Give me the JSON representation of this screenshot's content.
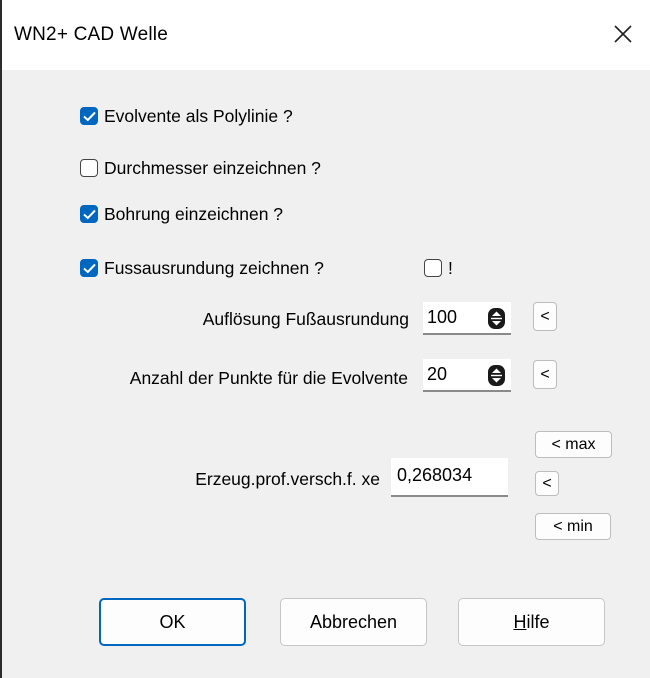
{
  "window": {
    "title": "WN2+ CAD Welle"
  },
  "options": [
    {
      "label": "Evolvente als Polylinie ?",
      "checked": true
    },
    {
      "label": "Durchmesser einzeichnen ?",
      "checked": false
    },
    {
      "label": "Bohrung einzeichnen ?",
      "checked": true
    },
    {
      "label": "Fussausrundung zeichnen ?",
      "checked": true
    }
  ],
  "extra_checkbox": {
    "label": "!",
    "checked": false
  },
  "resolution": {
    "label": "Auflösung Fußausrundung",
    "value": "100",
    "reset_label": "<"
  },
  "points": {
    "label": "Anzahl der Punkte für die Evolvente",
    "value": "20",
    "reset_label": "<"
  },
  "xe": {
    "label": "Erzeug.prof.versch.f. xe",
    "value": "0,268034",
    "max_label": "< max",
    "reset_label": "<",
    "min_label": "< min"
  },
  "buttons": {
    "ok": "OK",
    "cancel": "Abbrechen",
    "help_first": "H",
    "help_rest": "ilfe"
  },
  "colors": {
    "accent": "#0067c0",
    "dialog_bg": "#f0f0f0"
  }
}
